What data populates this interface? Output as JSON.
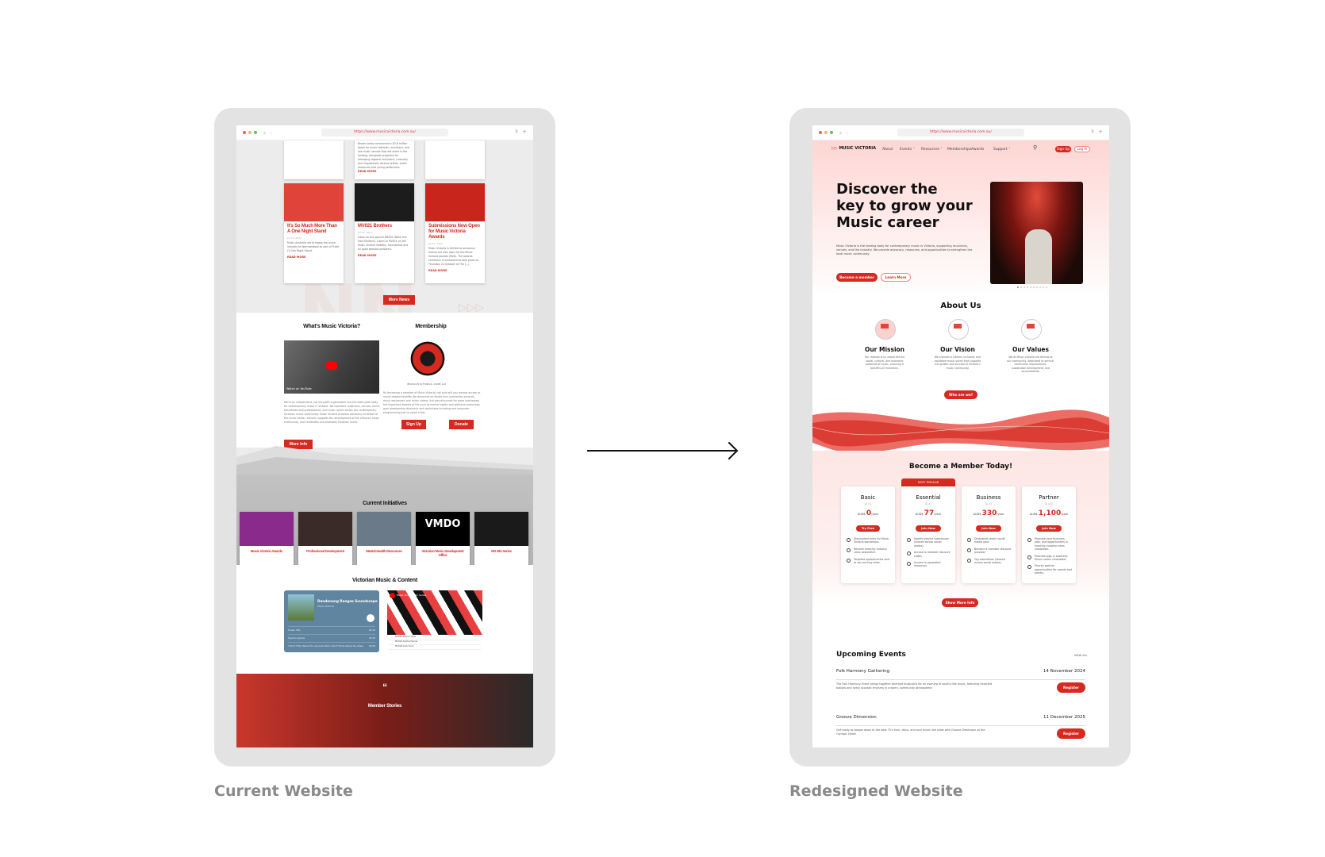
{
  "labels": {
    "current": "Current Website",
    "redesigned": "Redesigned Website"
  },
  "browser": {
    "url": "https://www.musicvictoria.com.au/"
  },
  "current_site": {
    "top_card_text": "Brooks today announced a $3.8 million boost for music festivals, musicians, and live music venues that will share in the funding, alongside programs for emerging regional musicians, culturally and linguistically diverse artists, event producers and young performers.",
    "read_more": "READ MORE",
    "news": [
      {
        "title": "It's So Much More Than A One Night Stand",
        "meta": "Jul 31, 2024",
        "body": "Music Australia are bringing the music industry to Warrnambool as part of Triple J's One Night Stand.",
        "img_color": "#e0433a"
      },
      {
        "title": "MV021 Brothers",
        "meta": "Jul 15, 2024",
        "body": "Listen to this special MAS0C Week mix from Brothers. Listen to MV021 on the Music Victoria website, Soundcloud and all good podcast providers.",
        "img_color": "#1c1c1c"
      },
      {
        "title": "Submissions Now Open for Music Victoria Awards",
        "meta": "Jul 01, 2024",
        "body": "Music Victoria is thrilled to announce entries are now open for the Music Victoria Awards (MVA). The awards ceremony is scheduled to take place on Thursday 24 October at The [...]",
        "img_color": "#c8261c"
      }
    ],
    "more_news": "More News",
    "whats_mv": {
      "heading": "What's Music Victoria?",
      "video_label": "Watch on YouTube",
      "body": "We're an independent, not-for-profit organisation and the state peak body for contemporary music in Victoria. We represent musicians, venues, music businesses and professionals, and music lovers across the contemporary Victorian music community. Music Victoria provides advocacy on behalf of the music sector, actively supports the development of the Victorian music community, and celebrates and promotes Victorian music.",
      "button": "More Info"
    },
    "membership": {
      "heading": "Membership",
      "logo_caption": "MUSICVICTORIA.COM.AU",
      "body": "By becoming a member of Music Victoria, not only will you receive access to music-related benefits like discounts on studio hire, production services, music equipment and music videos, but also discounts for more overlooked but important aspects of life such as mental health and wellness workshops, gym membership discounts and workshops including and computer programming just to name a few.",
      "signup": "Sign Up",
      "donate": "Donate"
    },
    "initiatives": {
      "heading": "Current Initiatives",
      "items": [
        {
          "label": "Music Victoria Awards",
          "color": "#8a2a8c"
        },
        {
          "label": "Professional Development",
          "color": "#3a2a28"
        },
        {
          "label": "Mental Health Resources",
          "color": "#6b7a88"
        },
        {
          "label": "Victorian Music Development Office",
          "color": "#000000",
          "logo": "VMDO"
        },
        {
          "label": "MV Mix Series",
          "color": "#1a1a1a"
        }
      ]
    },
    "content": {
      "heading": "Victorian Music & Content",
      "spotify": {
        "title": "Dandenong Ranges Soundscape",
        "artist": "Music Victoria",
        "tracks": [
          {
            "name": "Ocean Hills",
            "time": "04:10"
          },
          {
            "name": "Haydne Apples",
            "time": "03:45"
          },
          {
            "name": "I Don't Think About You Anymore But, I Don't Think About You Ahead",
            "time": "04:06"
          }
        ]
      },
      "youtube": {
        "title": "Music Victoria Mix Series",
        "tracks": [
          "MV020 Mauve Tides",
          "MV019 Sophie Farmer",
          "MV018 Arab Sonic"
        ]
      }
    },
    "member_stories": {
      "quote_mark": "“",
      "heading": "Member Stories"
    }
  },
  "redesigned_site": {
    "logo": "MUSIC VICTORIA",
    "nav": [
      "About",
      "Events ˅",
      "Resources ˅",
      "Memberships",
      "Awards",
      "Support ˅"
    ],
    "sign_up": "Sign Up",
    "log_in": "Log In",
    "hero": {
      "title_lines": [
        "Discover the",
        "key to grow your",
        "Music career"
      ],
      "body": "Music Victoria is the leading body for contemporary music in Victoria, supporting musicians, venues, and the industry. We provide advocacy, resources, and opportunities to strengthen the local music community.",
      "primary": "Become a member",
      "secondary": "Learn More",
      "carousel_total": 10,
      "carousel_active": 1
    },
    "about": {
      "heading": "About Us",
      "cols": [
        {
          "title": "Our Mission",
          "body": "Our mission is to unlock the full social, cultural, and economic potential of music, ensuring it benefits all Victorians."
        },
        {
          "title": "Our Vision",
          "body": "We envision a vibrant, inclusive, and equitable music scene that supports the growth and success of Victoria's music community."
        },
        {
          "title": "Our Values",
          "body": "We at Music Victoria are driving as our community, dedicated to service, continuous improvement, sustainable development, and accountability."
        }
      ],
      "button": "Who are we?"
    },
    "membership": {
      "heading": "Become a Member Today!",
      "popular": "MOST POPULAR",
      "plans": [
        {
          "name": "Basic",
          "users": "x1",
          "currency": "AUD$",
          "price": "0",
          "period": "/year",
          "button": "Try Free",
          "features": [
            "Discounted entry for Music Victoria workshops.",
            "Receive monthly industry news newsletter.",
            "Targeted opportunities sent to you as they arise."
          ]
        },
        {
          "name": "Essential",
          "users": "x1",
          "currency": "AUD$",
          "price": "77",
          "period": "/year",
          "button": "Join Now",
          "features": [
            "Spotify playlist submission (shared across social media).",
            "Access to member discount codes.",
            "Access to paywalled resources."
          ]
        },
        {
          "name": "Business",
          "users": "x5",
          "currency": "AUD$",
          "price": "330",
          "period": "/year",
          "button": "Join Now",
          "features": [
            "Dedicated yearly social media post.",
            "Become a member discount provider.",
            "Gig submission (shared across social media)."
          ]
        },
        {
          "name": "Partner",
          "users": "x10",
          "currency": "AUD$",
          "price": "1,100",
          "period": "/year",
          "button": "Join Now",
          "features": [
            "Promote your business, jobs, and opportunities in monthly industry news newsletter.",
            "Promote gigs in quarterly Music Lovers newsletter.",
            "Priority partner opportunities for events and panels."
          ]
        }
      ],
      "more": "Show More Info"
    },
    "events": {
      "heading": "Upcoming Events",
      "view_all": "VIEW ALL",
      "items": [
        {
          "title": "Folk Harmony Gathering",
          "date": "14 November 2024",
          "desc": "The Folk Harmony Event brings together talented musicians for an evening of soulful folk music, featuring heartfelt ballads and lively acoustic rhythms in a warm, community atmosphere.",
          "button": "Register"
        },
        {
          "title": "Groove Dimension",
          "date": "11 December 2025",
          "desc": "Get ready to boogie down to the best 70's funk, disco, and soul music live show with Groove Dimension at the Olympic Hotel!",
          "button": "Register"
        }
      ]
    }
  },
  "colors": {
    "brand_red": "#d42a20",
    "frame_gray": "#e3e3e3",
    "label_gray": "#8a8a8a"
  }
}
